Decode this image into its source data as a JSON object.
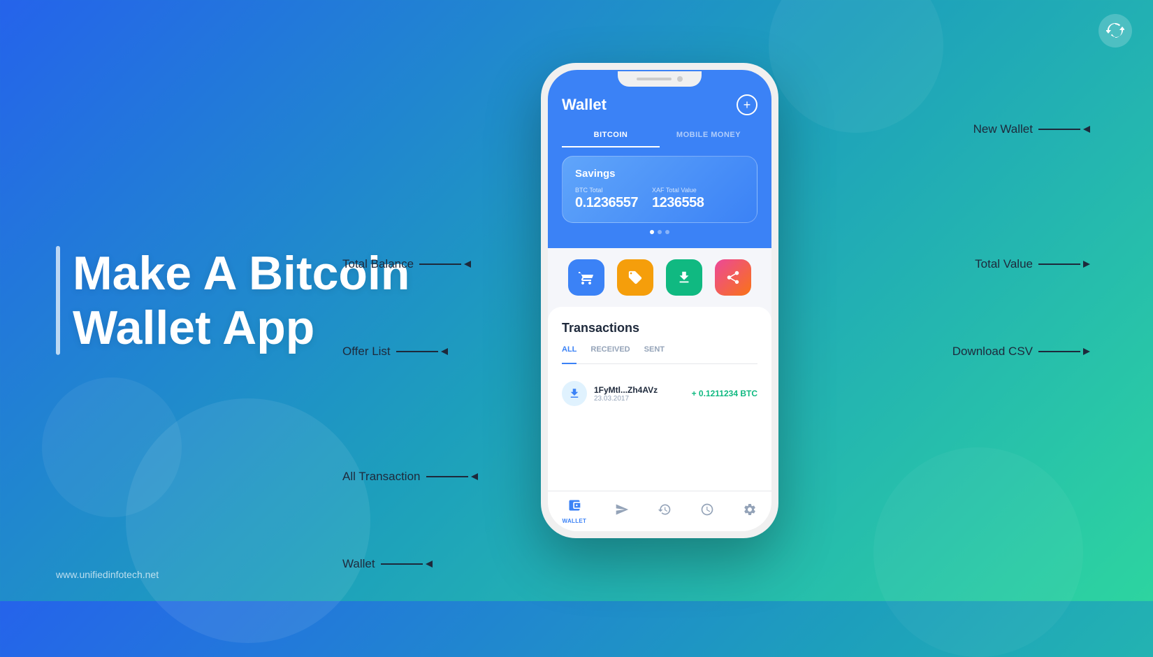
{
  "background": {
    "gradient": "linear-gradient(135deg, #2563eb 0%, #1d9fbc 50%, #2dd4a0 100%)"
  },
  "logo": {
    "symbol": "⟳"
  },
  "hero": {
    "title_line1": "Make A Bitcoin",
    "title_line2": "Wallet App",
    "website": "www.unifiedinfotech.net"
  },
  "annotations": {
    "new_wallet": "New Wallet",
    "total_balance": "Total Balance",
    "total_value": "Total Value",
    "offer_list": "Offer List",
    "download_csv": "Download CSV",
    "all_transaction": "All Transaction",
    "wallet_label": "Wallet"
  },
  "app": {
    "header_title": "Wallet",
    "plus_button": "+",
    "tabs": [
      {
        "label": "BITCOIN",
        "active": true
      },
      {
        "label": "MOBILE MONEY",
        "active": false
      }
    ],
    "savings_card": {
      "title": "Savings",
      "btc_label": "BTC Total",
      "btc_value": "0.1236557",
      "xaf_label": "XAF Total Value",
      "xaf_value": "1236558"
    },
    "action_buttons": [
      {
        "icon": "🛒",
        "color": "btn-blue",
        "name": "offer-list-btn"
      },
      {
        "icon": "🏷️",
        "color": "btn-orange",
        "name": "tag-btn"
      },
      {
        "icon": "⬇️",
        "color": "btn-green",
        "name": "download-btn"
      },
      {
        "icon": "↗️",
        "color": "btn-pink",
        "name": "share-btn"
      }
    ],
    "transactions_title": "Transactions",
    "tx_tabs": [
      {
        "label": "ALL",
        "active": true
      },
      {
        "label": "RECEIVED",
        "active": false
      },
      {
        "label": "SENT",
        "active": false
      }
    ],
    "transactions": [
      {
        "address": "1FyMtl...Zh4AVz",
        "date": "23.03.2017",
        "amount": "+ 0.1211234 BTC",
        "icon": "⬇"
      }
    ],
    "nav_items": [
      {
        "icon": "👛",
        "label": "WALLET",
        "active": true
      },
      {
        "icon": "↗",
        "label": "",
        "active": false
      },
      {
        "icon": "🕐",
        "label": "",
        "active": false
      },
      {
        "icon": "🕑",
        "label": "",
        "active": false
      },
      {
        "icon": "⚙",
        "label": "",
        "active": false
      }
    ]
  }
}
